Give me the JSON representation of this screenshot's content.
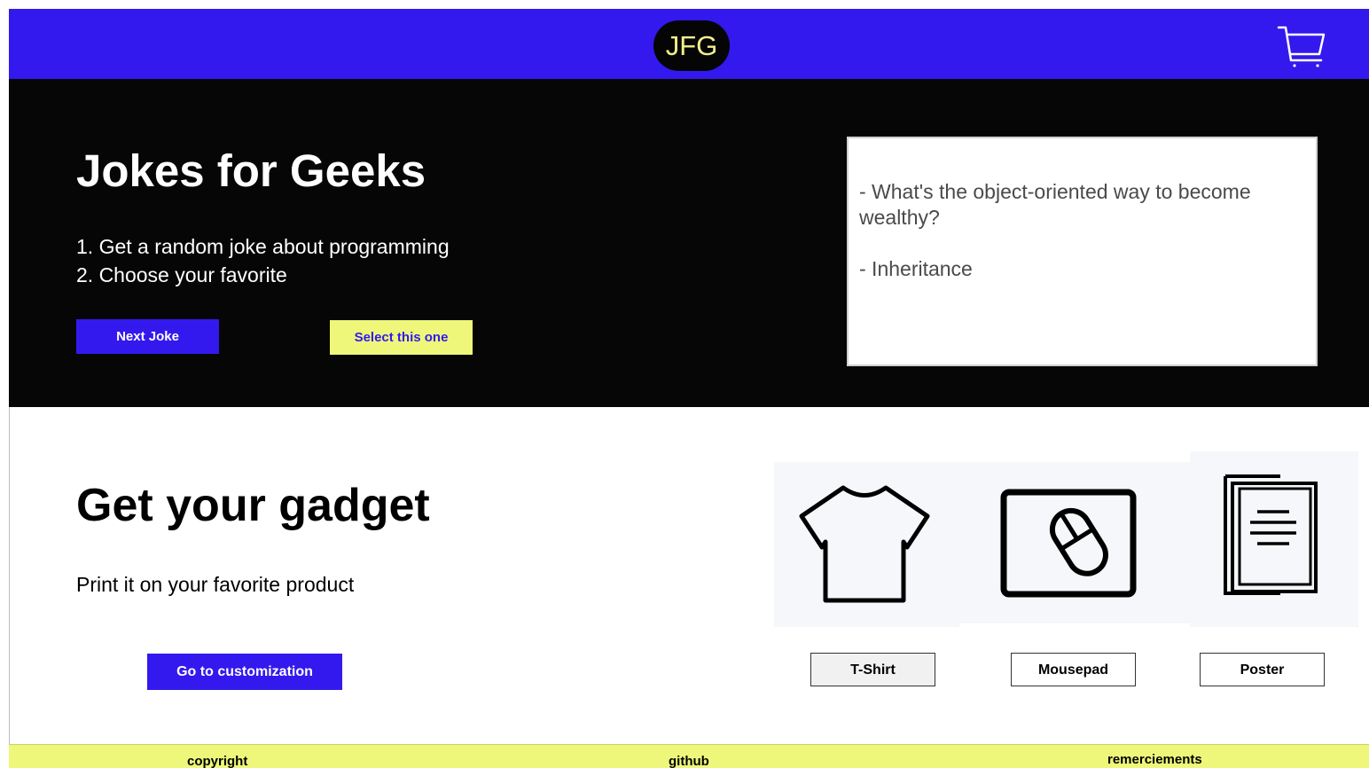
{
  "header": {
    "logo_text": "JFG",
    "cart_icon": "shopping-cart-icon",
    "colors": {
      "background": "#3319ee",
      "logo_bg": "#050505",
      "logo_text": "#f2ee8c"
    }
  },
  "hero": {
    "title": "Jokes for Geeks",
    "steps": [
      "1. Get a random joke about programming",
      "2. Choose your favorite"
    ],
    "next_button_label": "Next Joke",
    "select_button_label": "Select this one",
    "joke": {
      "question": "- What's the object-oriented way to become wealthy?",
      "answer": "- Inheritance"
    },
    "colors": {
      "background": "#060606",
      "primary": "#3319ee",
      "accent": "#eef77a"
    }
  },
  "gadget": {
    "title": "Get your gadget",
    "subtitle": "Print it on your favorite product",
    "customize_button_label": "Go to customization",
    "products": [
      {
        "label": "T-Shirt",
        "icon": "tshirt-icon"
      },
      {
        "label": "Mousepad",
        "icon": "mousepad-icon"
      },
      {
        "label": "Poster",
        "icon": "poster-icon"
      }
    ]
  },
  "footer": {
    "links": [
      "copyright",
      "github",
      "remerciements"
    ],
    "colors": {
      "background": "#eef77a"
    }
  }
}
